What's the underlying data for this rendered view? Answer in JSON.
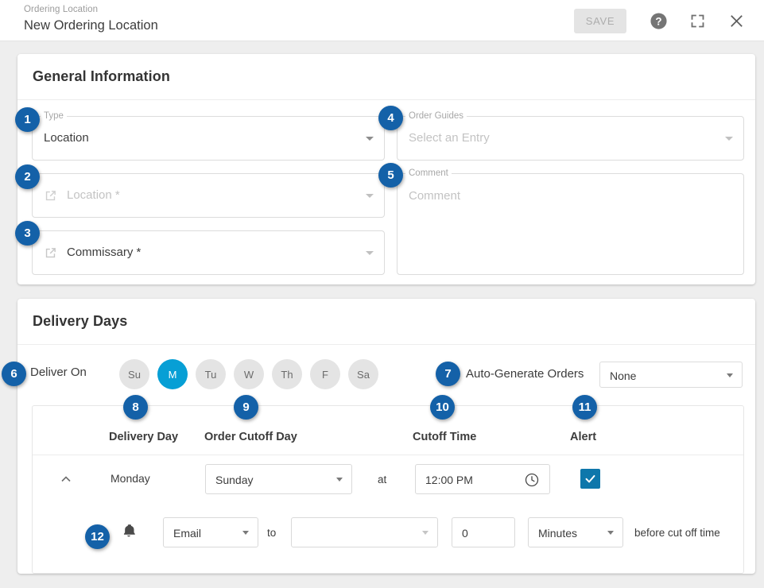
{
  "header": {
    "eyebrow": "Ordering Location",
    "title": "New Ordering Location",
    "save_label": "SAVE",
    "save_disabled": true,
    "icons": [
      "help-icon",
      "fullscreen-icon",
      "close-icon"
    ]
  },
  "general_information": {
    "section_title": "General Information",
    "fields": {
      "type": {
        "label": "Type",
        "value": "Location",
        "state": "filled"
      },
      "location": {
        "label": "",
        "value": "Location *",
        "state": "placeholder",
        "icon": "external-link-icon"
      },
      "commissary": {
        "label": "",
        "value": "Commissary *",
        "state": "placeholder",
        "icon": "external-link-icon"
      },
      "order_guides": {
        "label": "Order Guides",
        "placeholder": "Select an Entry",
        "value": "Select an Entry",
        "state": "placeholder"
      },
      "comment": {
        "label": "Comment",
        "placeholder": "Comment",
        "value": "",
        "state": "placeholder"
      }
    }
  },
  "delivery_days": {
    "section_title": "Delivery Days",
    "deliver_on_label": "Deliver On",
    "day_chips": [
      {
        "label": "Su",
        "selected": false
      },
      {
        "label": "M",
        "selected": true
      },
      {
        "label": "Tu",
        "selected": false
      },
      {
        "label": "W",
        "selected": false
      },
      {
        "label": "Th",
        "selected": false
      },
      {
        "label": "F",
        "selected": false
      },
      {
        "label": "Sa",
        "selected": false
      }
    ],
    "auto_generate": {
      "label": "Auto-Generate Orders",
      "value": "None",
      "options": [
        "None"
      ]
    },
    "table": {
      "headers": [
        "Delivery Day",
        "Order Cutoff Day",
        "Cutoff Time",
        "Alert"
      ],
      "rows": [
        {
          "delivery_day": "Monday",
          "order_cutoff_day": "Sunday",
          "at_label": "at",
          "cutoff_time": "12:00 PM",
          "cutoff_time_icon": "clock-icon",
          "alert_checked": true,
          "collapse_icon": "chevron-up-icon",
          "alert_row": {
            "bell_icon": "bell-icon",
            "channel": "Email",
            "to_label": "to",
            "recipient": "",
            "lead_value": "0",
            "lead_unit": "Minutes",
            "suffix_label": "before cut off time"
          }
        }
      ]
    }
  },
  "callouts": [
    {
      "n": "1"
    },
    {
      "n": "2"
    },
    {
      "n": "3"
    },
    {
      "n": "4"
    },
    {
      "n": "5"
    },
    {
      "n": "6"
    },
    {
      "n": "7"
    },
    {
      "n": "8"
    },
    {
      "n": "9"
    },
    {
      "n": "10"
    },
    {
      "n": "11"
    },
    {
      "n": "12"
    }
  ],
  "colors": {
    "badge": "#1461a8",
    "chip_selected": "#079fd5",
    "checkbox": "#0e77ab",
    "page_bg": "#eeeeee",
    "card_bg": "#ffffff"
  }
}
